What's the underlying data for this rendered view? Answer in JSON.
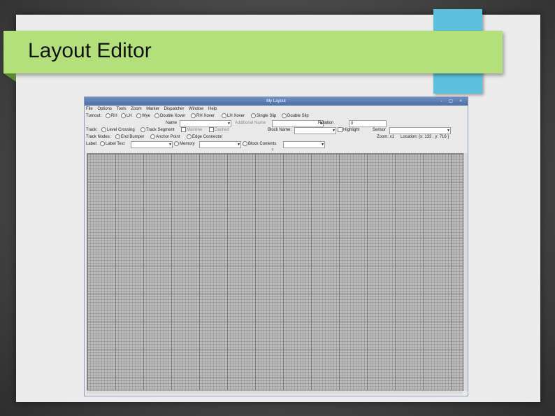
{
  "slide": {
    "title": "Layout Editor"
  },
  "window": {
    "title": "My Layout",
    "controls": "-  ▢  ×",
    "menu": [
      "File",
      "Options",
      "Tools",
      "Zoom",
      "Marker",
      "Dispatcher",
      "Window",
      "Help"
    ]
  },
  "toolbar": {
    "turnout_label": "Turnout:",
    "turnout_opts": [
      "RH",
      "LH",
      "Wye",
      "Double Xover",
      "RH Xover",
      "LH Xover",
      "Single Slip",
      "Double Slip"
    ],
    "name_label": "Name",
    "additional_name_label": "Additional Name",
    "rotation_label": "Rotation",
    "rotation_value": "0",
    "track_label": "Track:",
    "track_opts": [
      "Level Crossing",
      "Track Segment"
    ],
    "mainline_label": "Mainline",
    "dashed_label": "Dashed",
    "block_name_label": "Block Name:",
    "highlight_label": "Highlight",
    "sensor_label": "Sensor",
    "track_nodes_label": "Track Nodes:",
    "track_nodes_opts": [
      "End Bumper",
      "Anchor Point",
      "Edge Connector"
    ],
    "zoom_text": "Zoom: x1",
    "location_text": "Location: {x: 133 , y: 716 }",
    "label_label": "Label:",
    "label_text_opt": "Label Text",
    "memory_opt": "Memory",
    "block_contents_opt": "Block Contents"
  },
  "colors": {
    "title_band": "#b3e07a",
    "teal_tab": "#5dc1dd",
    "grid_major": "#7c7c7c",
    "grid_bg": "#bdbdbd"
  }
}
